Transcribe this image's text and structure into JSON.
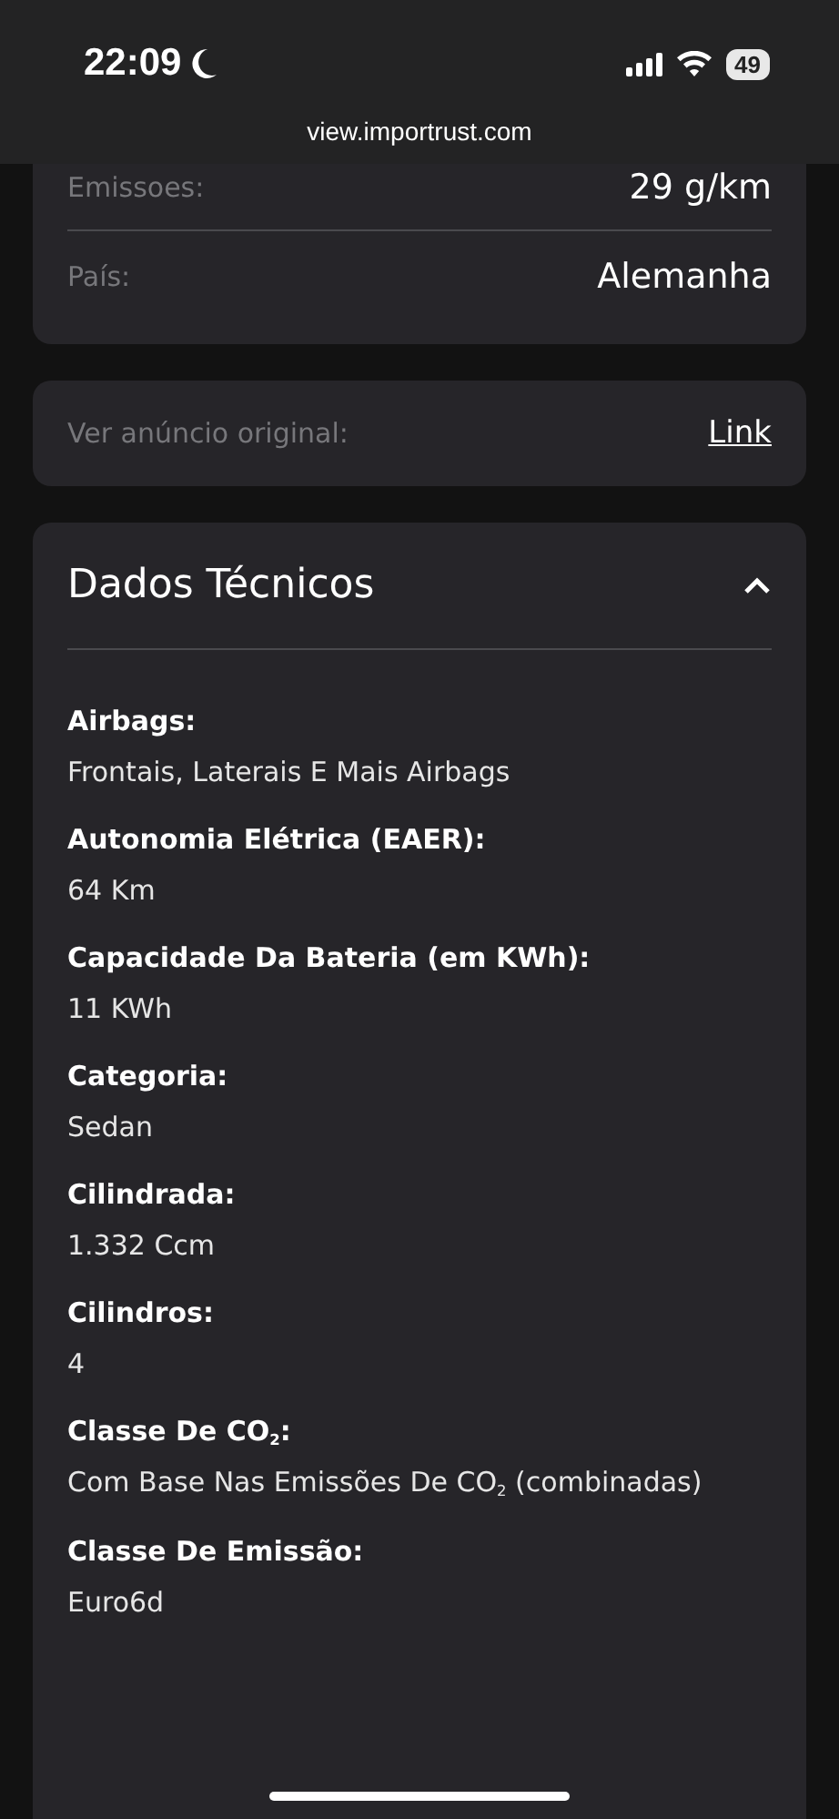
{
  "status_bar": {
    "time": "22:09",
    "battery": "49"
  },
  "address_bar": {
    "url": "view.importrust.com"
  },
  "summary": [
    {
      "label": "Emissoes:",
      "value": "29 g/km"
    },
    {
      "label": "País:",
      "value": "Alemanha"
    }
  ],
  "original_ad": {
    "label": "Ver anúncio original:",
    "link": "Link"
  },
  "technical": {
    "title": "Dados Técnicos",
    "expanded": true,
    "items": [
      {
        "label": "Airbags:",
        "value": "Frontais, Laterais E Mais Airbags"
      },
      {
        "label": "Autonomia Elétrica (EAER):",
        "value": "64 Km"
      },
      {
        "label": "Capacidade Da Bateria (em KWh):",
        "value": "11 KWh"
      },
      {
        "label": "Categoria:",
        "value": "Sedan"
      },
      {
        "label": "Cilindrada:",
        "value": "1.332 Ccm"
      },
      {
        "label": "Cilindros:",
        "value": "4"
      },
      {
        "label": "Classe De CO$_{2}$:",
        "value": "Com Base Nas Emissões De CO$_{2}$ (combinadas)"
      },
      {
        "label": "Classe De Emissão:",
        "value": "Euro6d"
      }
    ]
  }
}
